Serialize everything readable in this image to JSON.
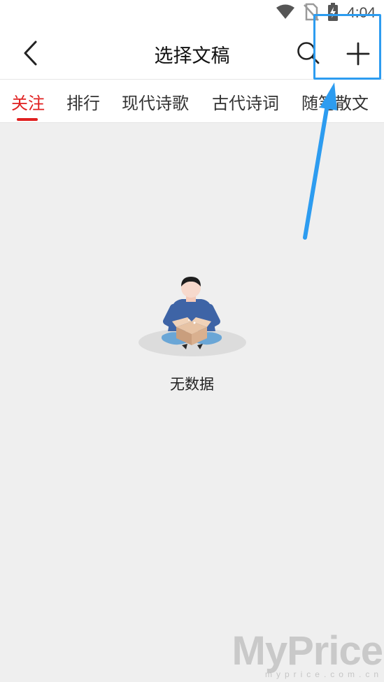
{
  "status_bar": {
    "time": "4:04",
    "icons": [
      "wifi-icon",
      "no-sim-icon",
      "battery-charging-icon"
    ]
  },
  "header": {
    "title": "选择文稿",
    "back_icon": "chevron-left-icon",
    "search_icon": "search-icon",
    "add_icon": "plus-icon"
  },
  "tabs": [
    {
      "label": "关注",
      "active": true
    },
    {
      "label": "排行",
      "active": false
    },
    {
      "label": "现代诗歌",
      "active": false
    },
    {
      "label": "古代诗词",
      "active": false
    },
    {
      "label": "随笔散文",
      "active": false
    }
  ],
  "empty_state": {
    "message": "无数据",
    "illustration": "person-with-empty-box"
  },
  "annotation": {
    "target": "add-button",
    "color": "#2d9cf0"
  },
  "watermark": {
    "logo": "MyPrice",
    "url": "myprice.com.cn"
  },
  "colors": {
    "accent": "#e02020",
    "background": "#efefef",
    "header": "#ffffff"
  }
}
